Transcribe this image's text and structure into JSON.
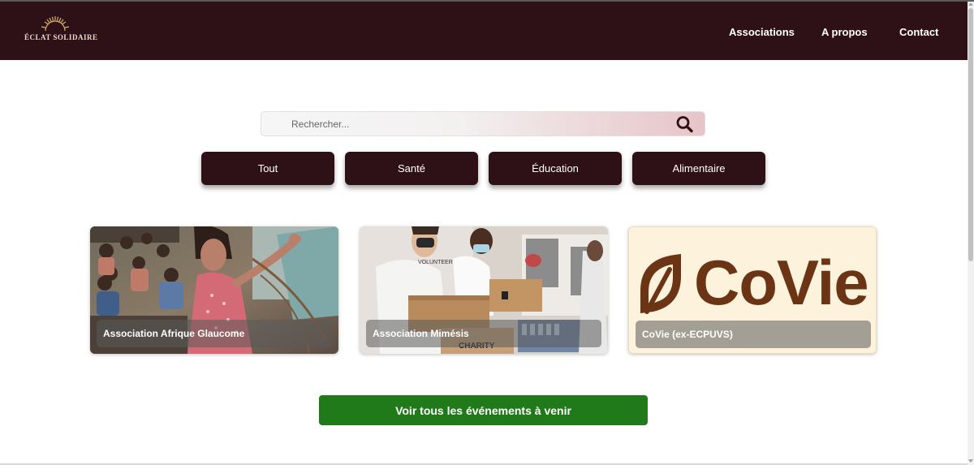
{
  "header": {
    "logo_text": "ÉCLAT SOLIDAIRE",
    "nav": [
      {
        "label": "Associations"
      },
      {
        "label": "A propos"
      },
      {
        "label": "Contact"
      }
    ]
  },
  "search": {
    "placeholder": "Rechercher...",
    "icon": "search-icon"
  },
  "filters": [
    {
      "label": "Tout"
    },
    {
      "label": "Santé"
    },
    {
      "label": "Éducation"
    },
    {
      "label": "Alimentaire"
    }
  ],
  "cards": [
    {
      "title": "Association Afrique Glaucome"
    },
    {
      "title": "Association Mimésis"
    },
    {
      "title": "CoVie (ex-ECPUVS)",
      "logo_text": "CoVie"
    }
  ],
  "cta": {
    "label": "Voir tous les événements à venir"
  },
  "colors": {
    "header_bg": "#2e1117",
    "filter_bg": "#2e1117",
    "cta_bg": "#217a1a",
    "covie_bg": "#fdf3dc",
    "covie_brown": "#6b3414"
  }
}
